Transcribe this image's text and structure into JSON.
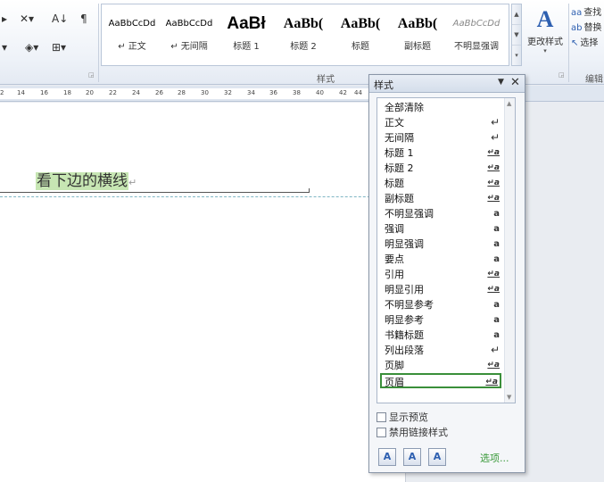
{
  "ribbon": {
    "para_tools": {
      "row1": [
        "▸",
        "✕▾",
        "A↓",
        "¶"
      ],
      "row2": [
        "▾",
        "◈▾",
        "⊞▾"
      ]
    },
    "gallery_styles": [
      {
        "sample": "AaBbCcDd",
        "name": "↵ 正文",
        "kind": "small"
      },
      {
        "sample": "AaBbCcDd",
        "name": "↵ 无间隔",
        "kind": "small"
      },
      {
        "sample": "AaBł",
        "name": "标题 1",
        "kind": "big"
      },
      {
        "sample": "AaBb(",
        "name": "标题 2",
        "kind": "mid"
      },
      {
        "sample": "AaBb(",
        "name": "标题",
        "kind": "mid"
      },
      {
        "sample": "AaBb(",
        "name": "副标题",
        "kind": "mid"
      },
      {
        "sample": "AaBbCcDd",
        "name": "不明显强调",
        "kind": "ital"
      }
    ],
    "group_label_styles": "样式",
    "change_styles": {
      "icon": "A",
      "label": "更改样式",
      "dropdown": "▾"
    },
    "edit_group": {
      "items": [
        {
          "icon": "aa",
          "label": "查找"
        },
        {
          "icon": "ab",
          "label": "替换"
        },
        {
          "icon": "↖",
          "label": "选择"
        }
      ],
      "label": "编辑"
    }
  },
  "ruler": {
    "ticks": [
      "2",
      "14",
      "16",
      "18",
      "20",
      "22",
      "24",
      "26",
      "28",
      "30",
      "32",
      "34",
      "36",
      "38",
      "40",
      "42",
      "44"
    ]
  },
  "document": {
    "text": "看下边的横线",
    "para_mark": "↵"
  },
  "styles_pane": {
    "title": "样式",
    "menu_icon": "▼",
    "close_icon": "✕",
    "styles": [
      {
        "name": "全部清除",
        "indicator": ""
      },
      {
        "name": "正文",
        "indicator": "↵"
      },
      {
        "name": "无间隔",
        "indicator": "↵"
      },
      {
        "name": "标题 1",
        "indicator": "↵a"
      },
      {
        "name": "标题 2",
        "indicator": "↵a"
      },
      {
        "name": "标题",
        "indicator": "↵a"
      },
      {
        "name": "副标题",
        "indicator": "↵a"
      },
      {
        "name": "不明显强调",
        "indicator": "a"
      },
      {
        "name": "强调",
        "indicator": "a"
      },
      {
        "name": "明显强调",
        "indicator": "a"
      },
      {
        "name": "要点",
        "indicator": "a"
      },
      {
        "name": "引用",
        "indicator": "↵a"
      },
      {
        "name": "明显引用",
        "indicator": "↵a"
      },
      {
        "name": "不明显参考",
        "indicator": "a"
      },
      {
        "name": "明显参考",
        "indicator": "a"
      },
      {
        "name": "书籍标题",
        "indicator": "a"
      },
      {
        "name": "列出段落",
        "indicator": "↵"
      },
      {
        "name": "页脚",
        "indicator": "↵a"
      },
      {
        "name": "页眉",
        "indicator": "↵a"
      }
    ],
    "selected_style": "页眉",
    "show_preview": "显示预览",
    "disable_linked": "禁用链接样式",
    "buttons": [
      "A",
      "A",
      "A"
    ],
    "options_link": "选项..."
  }
}
